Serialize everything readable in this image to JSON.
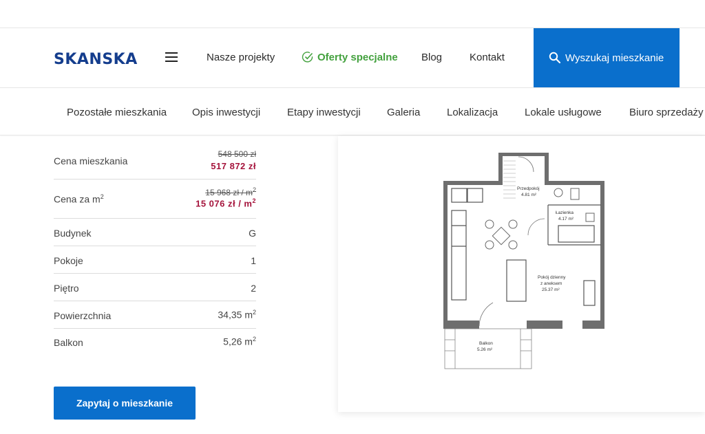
{
  "header": {
    "logo": "SKANSKA",
    "nav": [
      {
        "label": "Nasze projekty"
      },
      {
        "label": "Oferty specjalne"
      },
      {
        "label": "Blog"
      },
      {
        "label": "Kontakt"
      }
    ],
    "search_label": "Wyszukaj mieszkanie"
  },
  "subnav": [
    {
      "label": "Pozostałe mieszkania"
    },
    {
      "label": "Opis inwestycji"
    },
    {
      "label": "Etapy inwestycji"
    },
    {
      "label": "Galeria"
    },
    {
      "label": "Lokalizacja"
    },
    {
      "label": "Lokale usługowe"
    },
    {
      "label": "Biuro sprzedaży"
    }
  ],
  "details": {
    "price": {
      "label": "Cena mieszkania",
      "old": "548 500 zł",
      "new": "517 872 zł"
    },
    "price_m2": {
      "label": "Cena za m",
      "old": "15 968 zł / m",
      "new": "15 076 zł / m"
    },
    "rows": [
      {
        "label": "Budynek",
        "value": "G"
      },
      {
        "label": "Pokoje",
        "value": "1"
      },
      {
        "label": "Piętro",
        "value": "2"
      },
      {
        "label": "Powierzchnia",
        "value": "34,35 m"
      },
      {
        "label": "Balkon",
        "value": "5,26 m"
      }
    ],
    "sup": "2"
  },
  "ask_button": "Zapytaj o mieszkanie",
  "floorplan": {
    "rooms": [
      {
        "name": "Przedpokój",
        "area": "4.81 m²"
      },
      {
        "name": "Łazienka",
        "area": "4.17 m²"
      },
      {
        "name": "Pokój dzienny",
        "name2": "z aneksem",
        "area": "25.37 m²"
      },
      {
        "name": "Balkon",
        "area": "5.26 m²"
      }
    ]
  },
  "colors": {
    "brand": "#143d8d",
    "accent": "#0a6fcc",
    "special": "#43a13e",
    "price": "#a5143c"
  },
  "icons": {
    "menu": "hamburger-icon",
    "special": "check-circle-icon",
    "search": "search-icon"
  }
}
